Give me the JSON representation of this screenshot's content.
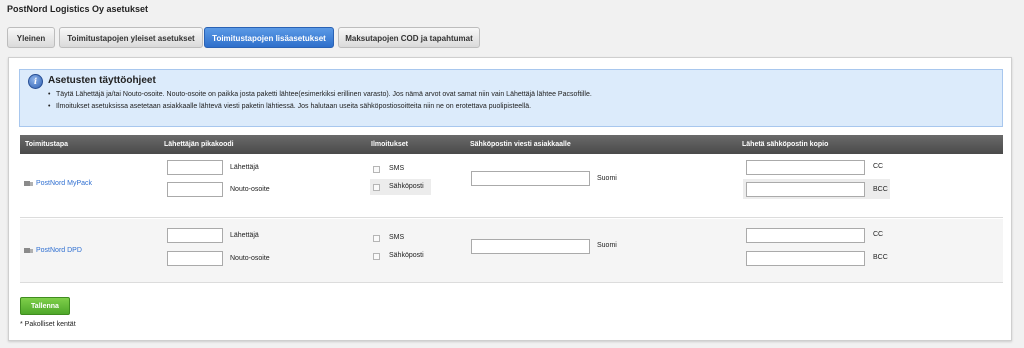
{
  "page": {
    "title": "PostNord Logistics Oy asetukset"
  },
  "tabs": [
    {
      "label": "Yleinen",
      "active": false
    },
    {
      "label": "Toimitustapojen yleiset asetukset",
      "active": false
    },
    {
      "label": "Toimitustapojen lisäasetukset",
      "active": true
    },
    {
      "label": "Maksutapojen COD ja tapahtumat",
      "active": false
    }
  ],
  "info": {
    "title": "Asetusten täyttöohjeet",
    "items": [
      "Täytä Lähettäjä ja/tai Nouto-osoite. Nouto-osoite on paikka josta paketti lähtee(esimerkiksi erillinen varasto). Jos nämä arvot ovat samat niin vain Lähettäjä lähtee Pacsoftille.",
      "Ilmoitukset asetuksissa asetetaan asiakkaalle lähtevä viesti paketin lähtiessä. Jos halutaan useita sähköpostiosoitteita niin ne on erotettava puolipisteellä."
    ]
  },
  "table": {
    "headers": [
      "Toimitustapa",
      "Lähettäjän pikakoodi",
      "Ilmoitukset",
      "Sähköpostin viesti asiakkaalle",
      "Lähetä sähköpostin kopio"
    ],
    "rows": [
      {
        "method": "PostNord MyPack",
        "sender_label": "Lähettäjä",
        "sender_value": "",
        "pickup_label": "Nouto-osoite",
        "pickup_value": "",
        "sms_label": "SMS",
        "sms_checked": false,
        "email_label": "Sähköposti",
        "email_checked": false,
        "message_value": "",
        "message_lang": "Suomi",
        "cc_label": "CC",
        "cc_value": "",
        "bcc_label": "BCC",
        "bcc_value": ""
      },
      {
        "method": "PostNord DPD",
        "sender_label": "Lähettäjä",
        "sender_value": "",
        "pickup_label": "Nouto-osoite",
        "pickup_value": "",
        "sms_label": "SMS",
        "sms_checked": false,
        "email_label": "Sähköposti",
        "email_checked": false,
        "message_value": "",
        "message_lang": "Suomi",
        "cc_label": "CC",
        "cc_value": "",
        "bcc_label": "BCC",
        "bcc_value": ""
      }
    ]
  },
  "actions": {
    "save_label": "Tallenna"
  },
  "footer": {
    "required_note": "* Pakolliset kentät"
  },
  "colors": {
    "active_tab": "#3b7fd8",
    "header_bg": "#555555",
    "save": "#5cb531",
    "link": "#2f6fd1"
  }
}
